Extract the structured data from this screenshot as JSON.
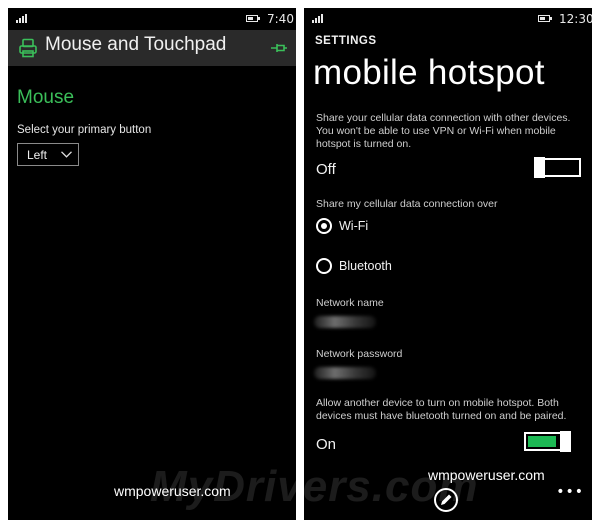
{
  "left": {
    "status": {
      "time": "7:40"
    },
    "header": {
      "title": "Mouse and Touchpad",
      "icon": "mouse-settings-icon",
      "pin_icon": "pin-icon"
    },
    "section_title": "Mouse",
    "primary_button": {
      "label": "Select your primary button",
      "value": "Left"
    },
    "watermark": "wmpoweruser.com"
  },
  "right": {
    "status": {
      "time": "12:30"
    },
    "settings_label": "SETTINGS",
    "title": "mobile hotspot",
    "description": "Share your cellular data connection with other devices. You won't be able to use VPN or Wi-Fi when mobile hotspot is turned on.",
    "hotspot_toggle": {
      "label": "Off",
      "on": false
    },
    "share_over": {
      "label": "Share my cellular data connection over",
      "options": [
        {
          "label": "Wi-Fi",
          "selected": true
        },
        {
          "label": "Bluetooth",
          "selected": false
        }
      ]
    },
    "network_name_label": "Network name",
    "network_password_label": "Network password",
    "remote_description": "Allow another device to turn on mobile hotspot. Both devices must have bluetooth turned on and be paired.",
    "remote_toggle": {
      "label": "On",
      "on": true
    },
    "watermark": "wmpoweruser.com",
    "appbar": {
      "edit_icon": "edit-icon",
      "more": "•••"
    }
  },
  "overlay_watermark": "MyDrivers.com",
  "colors": {
    "accent": "#3bbf5a",
    "toggle_on": "#1db954",
    "background": "#000000"
  }
}
